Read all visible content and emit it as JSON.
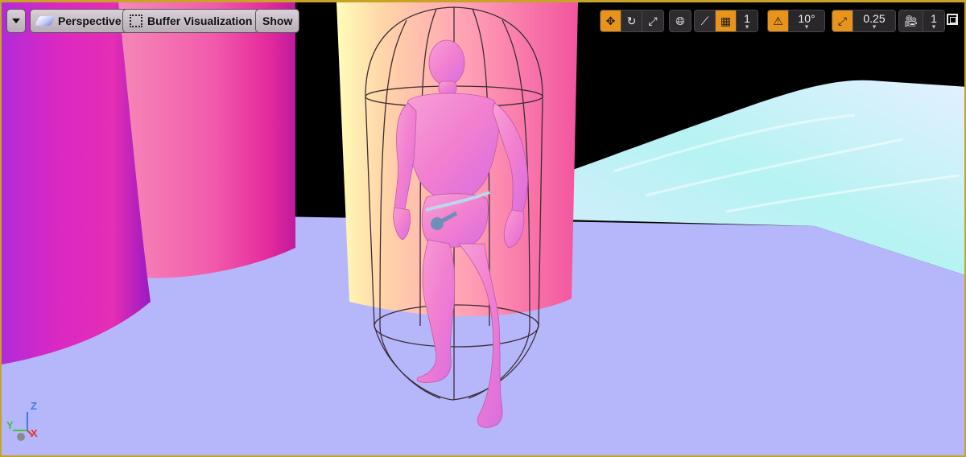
{
  "viewport": {
    "menu_icon": "chevron-down-icon",
    "perspective_label": "Perspective",
    "buffer_visualization_label": "Buffer Visualization",
    "show_label": "Show"
  },
  "transform_toolbar": {
    "tools": [
      "translate-icon",
      "rotate-icon",
      "scale-icon"
    ],
    "coordinate_space_icon": "globe-icon",
    "surface_snapping_icon": "surface-snap-icon",
    "grid_snap": {
      "icon": "grid-icon",
      "value": "1"
    },
    "rotation_snap": {
      "icon": "rotation-snap-icon",
      "value": "10°"
    },
    "scale_snap": {
      "icon": "scale-snap-icon",
      "value": "0.25"
    },
    "camera_speed": {
      "icon": "camera-speed-icon",
      "value": "1"
    }
  },
  "axis_gizmo": {
    "x": "X",
    "y": "Y",
    "z": "Z"
  },
  "colors": {
    "accent_orange": "#e8941b",
    "frame_gold": "#c9a227",
    "floor": "#b6b6fb",
    "sky": "#000000"
  }
}
